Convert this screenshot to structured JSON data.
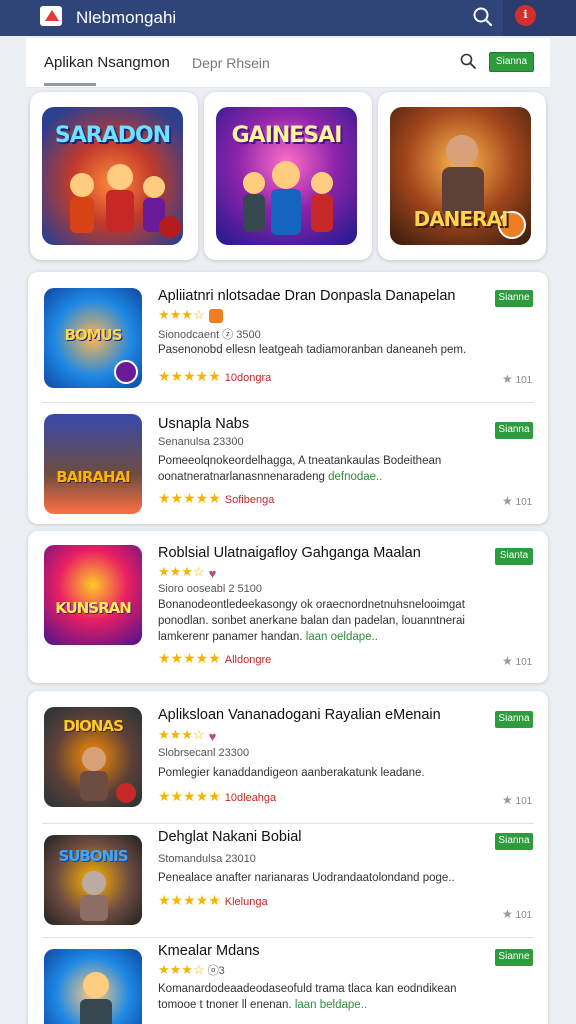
{
  "header": {
    "app_title": "Nlebmongahi"
  },
  "tabs": {
    "tab1": "Aplikan Nsangmon",
    "tab2": "Depr Rhsein",
    "button": "Sianna"
  },
  "featured": [
    {
      "title": "SARADON",
      "bg": "#2d3f8f"
    },
    {
      "title": "GAINESAI",
      "bg": "#4a2a7a"
    },
    {
      "title": "DANERAI",
      "bg": "#7a3a1c"
    }
  ],
  "stars_full": "★★★★★",
  "stars_partial": "★★★☆",
  "items": [
    {
      "title": "Apliiatnri nlotsadae Dran Donpasla Danapelan",
      "sub": "Sionodcaent ⓩ 3500",
      "desc": "Pasenonobd ellesn leatgeah tadiamoranban daneaneh pem.",
      "desc_green": "",
      "rating": "10dongra",
      "install": "Sianne",
      "mini": "101",
      "thumb": "BOMUS"
    },
    {
      "title": "Usnapla Nabs",
      "sub": "Senanulsa 23300",
      "desc": "Pomeeolqnokeordelhagga, A tneatankaulas Bodeithean oonatneratnarlanasnnenaradeng",
      "desc_green": "defnodae..",
      "rating": "Sofibenga",
      "install": "Sianna",
      "mini": "101",
      "thumb": "BAIRAHAI"
    },
    {
      "title": "Roblsial Ulatnaigafloy Gahganga Maalan",
      "sub": "Sioro ooseabl 2 5100",
      "desc": "Bonanodeontledeekasongy ok oraecnordnetnuhsnelooimgat ponodlan. sonbet anerkane balan dan padelan, louanntnerai lamkerenr panamer handan.",
      "desc_green": "laan oeldape..",
      "rating": "Alldongre",
      "install": "Sianta",
      "mini": "101",
      "thumb": "KUNSRAN"
    },
    {
      "title": "Apliksloan Vananadogani Rayalian eMenain",
      "sub": "Slobrsecanl 23300",
      "desc": "Pomlegier kanaddandigeon aanberakatunk leadane.",
      "desc_green": "",
      "rating": "10dleahga",
      "install": "Sianna",
      "mini": "101",
      "thumb": "DIONAS"
    },
    {
      "title": "Dehglat Nakani Bobial",
      "sub": "Stomandulsa 23010",
      "desc": "Penealace anafter narianaras Uodrandaatolondand poge..",
      "desc_green": "",
      "rating": "Klelunga",
      "install": "Sianna",
      "mini": "101",
      "thumb": "SUBONIS"
    },
    {
      "title": "Kmealar Mdans",
      "sub": "ⓞ3",
      "desc": "Komanardodeaadeodaseofuld trama tlaca kan eodndikean tomooe t tnoner ll enenan.",
      "desc_green": "laan beldape..",
      "rating": "",
      "install": "Sianne",
      "mini": "",
      "thumb": ""
    }
  ],
  "colors": {
    "header": "#2f4478",
    "install": "#2e9c3d",
    "star": "#f5b400",
    "rating_text": "#c62828"
  }
}
